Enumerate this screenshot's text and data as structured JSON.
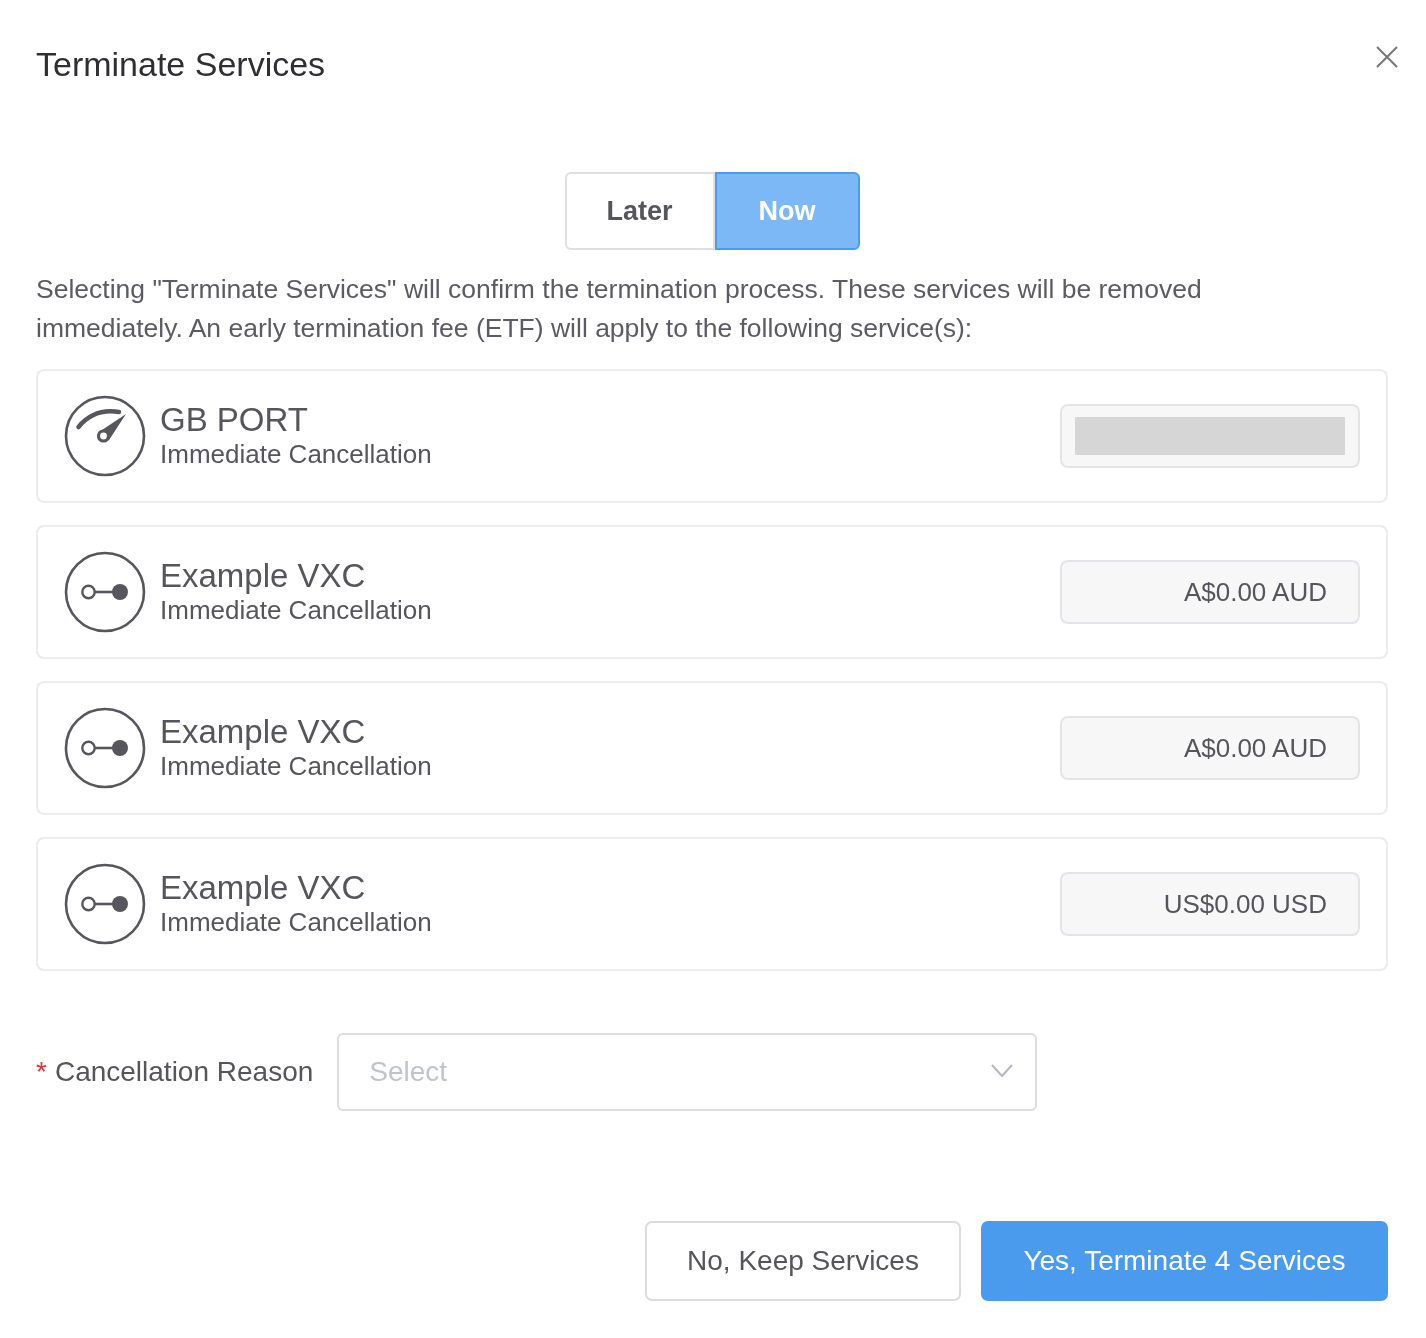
{
  "dialog": {
    "title": "Terminate Services"
  },
  "timing_options": [
    {
      "label": "Later",
      "selected": false
    },
    {
      "label": "Now",
      "selected": true
    }
  ],
  "message": "Selecting \"Terminate Services\" will confirm the termination process. These services will be removed immediately. An early termination fee (ETF) will apply to the following service(s):",
  "services": [
    {
      "kind": "port",
      "name": "GB PORT",
      "subtitle": "Immediate Cancellation",
      "loading": true
    },
    {
      "kind": "vxc",
      "name": "Example VXC",
      "subtitle": "Immediate Cancellation",
      "loading": false,
      "fee": "A$0.00 AUD"
    },
    {
      "kind": "vxc",
      "name": "Example VXC",
      "subtitle": "Immediate Cancellation",
      "loading": false,
      "fee": "A$0.00 AUD"
    },
    {
      "kind": "vxc",
      "name": "Example VXC",
      "subtitle": "Immediate Cancellation",
      "loading": false,
      "fee": "US$0.00 USD"
    }
  ],
  "reason": {
    "required_mark": "*",
    "label": "Cancellation Reason",
    "placeholder": "Select"
  },
  "actions": [
    {
      "kind": "secondary",
      "label": "No, Keep Services"
    },
    {
      "kind": "primary",
      "label": "Yes, Terminate 4 Services"
    }
  ]
}
